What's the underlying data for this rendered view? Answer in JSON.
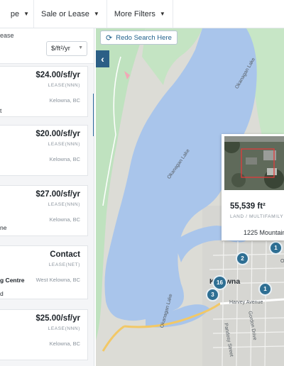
{
  "filters": {
    "type_label": "pe",
    "sale_or_lease_label": "Sale or Lease",
    "more_filters_label": "More Filters"
  },
  "list": {
    "lease_label": "ease",
    "unit_select_value": "$/ft²/yr",
    "cards": [
      {
        "price": "$24.00/sf/yr",
        "type": "LEASE(NNN)",
        "city": "Kelowna, BC",
        "frag": "t"
      },
      {
        "price": "$20.00/sf/yr",
        "type": "LEASE(NNN)",
        "city": "Kelowna, BC"
      },
      {
        "price": "$27.00/sf/yr",
        "type": "LEASE(NNN)",
        "city": "Kelowna, BC",
        "frag": "ne"
      },
      {
        "price": "Contact",
        "type": "LEASE(NET)",
        "name": "g Centre",
        "city": "West Kelowna, BC",
        "frag": "d"
      },
      {
        "price": "$25.00/sf/yr",
        "type": "LEASE(NNN)",
        "city": "Kelowna, BC"
      }
    ]
  },
  "map": {
    "redo_label": "Redo Search Here",
    "collapse_glyph": "‹",
    "labels": {
      "lake1": "Okanagan Lake",
      "lake2": "Okanagan Lake",
      "lake3": "Okanagan Lake",
      "city": "Kelowna",
      "city_frag": "Ke",
      "harvey": "Harvey Avenue",
      "gordon": "Gordon Drive",
      "pandosy": "Pandosy Street",
      "other_frag": "O"
    },
    "clusters": [
      "1",
      "2",
      "16",
      "3",
      "1"
    ],
    "popup": {
      "area": "55,539 ft²",
      "type": "LAND / MULTIFAMILY",
      "address": "1225 Mountain"
    }
  },
  "colors": {
    "brand_blue": "#2c5f86",
    "water": "#a9c5eb",
    "park": "#bde3bf",
    "cluster": "#2e6f93"
  }
}
